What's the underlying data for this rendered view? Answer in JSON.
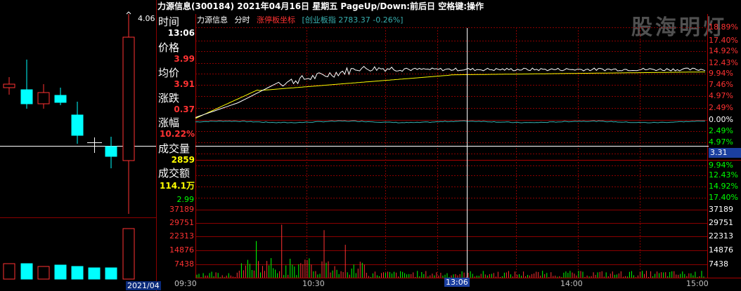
{
  "header": {
    "title": "力源信息(300184)  2021年04月16日  星期五  PageUp/Down:前后日  空格键:操作",
    "watermark": "股海明灯"
  },
  "legend": {
    "name": "力源信息",
    "mode": "分时",
    "limit": "涨停板坐标",
    "index": "[创业板指 2783.37 -0.26%]"
  },
  "info_panel": {
    "time_label": "时间",
    "time_value": "13:06",
    "price_label": "价格",
    "price_value": "3.99",
    "avg_label": "均价",
    "avg_value": "3.91",
    "chg_label": "涨跌",
    "chg_value": "0.37",
    "pct_label": "涨幅",
    "pct_value": "10.22%",
    "vol_label": "成交量",
    "vol_value": "2859",
    "amt_label": "成交额",
    "amt_value": "114.1万"
  },
  "kline": {
    "high_label": "4.06",
    "date_tag": "2021/04"
  },
  "right_axis_up": [
    "18.89%",
    "17.40%",
    "14.92%",
    "12.43%",
    "9.94%",
    "7.46%",
    "4.97%",
    "2.49%",
    "0.00%"
  ],
  "right_axis_down": [
    "2.49%",
    "4.97%",
    "",
    "9.94%",
    "12.43%",
    "14.92%",
    "17.40%"
  ],
  "cursor_value": "3.31",
  "left_price_low": "2.99",
  "volume_axis": [
    "37189",
    "29751",
    "22313",
    "14876",
    "7438"
  ],
  "time_axis": [
    "09:30",
    "10:30",
    "13:06",
    "14:00",
    "15:00"
  ],
  "colors": {
    "up": "#ff3232",
    "down": "#00ffff",
    "grid": "#8b0000",
    "price_line": "#ffffff",
    "avg_line": "#ffff00",
    "index_line": "#38b0b0",
    "volume_up": "#ff3232",
    "volume_down": "#00ff00"
  }
}
